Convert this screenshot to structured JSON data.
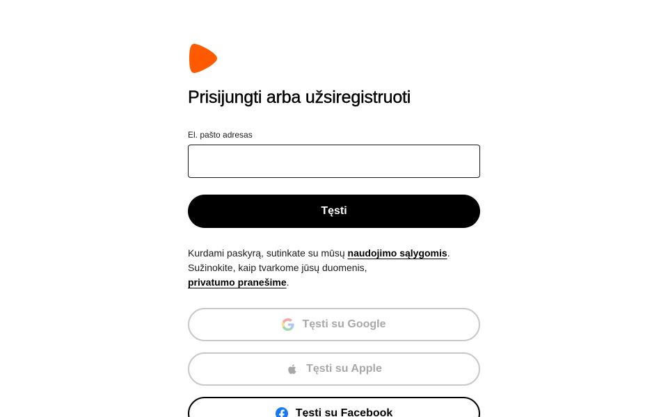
{
  "form": {
    "title": "Prisijungti arba užsiregistruoti",
    "email_label": "El. pašto adresas",
    "email_value": "",
    "continue_label": "Tęsti"
  },
  "legal": {
    "text_1": "Kurdami paskyrą, sutinkate su mūsų ",
    "terms_link": "naudojimo sąlygomis",
    "text_2": ".",
    "text_3": "Sužinokite, kaip tvarkome jūsų duomenis,",
    "privacy_link": "privatumo pranešime",
    "text_4": "."
  },
  "social": {
    "google_label": "Tęsti su Google",
    "apple_label": "Tęsti su Apple",
    "facebook_label": "Tęsti su Facebook"
  },
  "icons": {
    "brand_logo": "zalando-logo",
    "google": "google-icon",
    "apple": "apple-icon",
    "facebook": "facebook-icon"
  },
  "colors": {
    "brand_orange": "#ff5a00",
    "facebook_blue": "#1877f2",
    "disabled_text": "#a8a8a8",
    "disabled_border": "#c8c8c8"
  }
}
